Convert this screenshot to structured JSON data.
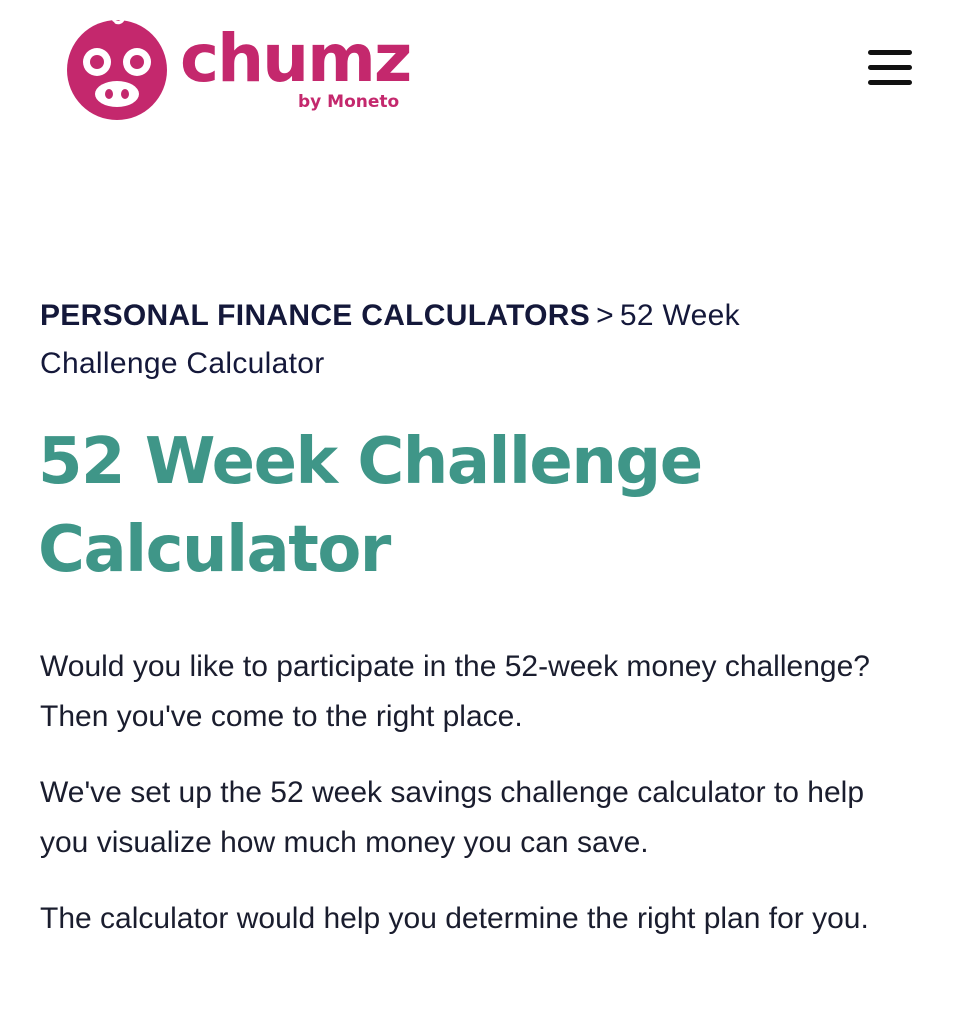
{
  "brand": {
    "name": "chumz",
    "byline": "by Moneto",
    "color": "#c4286d"
  },
  "header": {
    "menu_icon": "hamburger-menu-icon"
  },
  "breadcrumb": {
    "parent": "PERSONAL FINANCE CALCULATORS",
    "separator": ">",
    "current": "52 Week Challenge Calculator"
  },
  "page": {
    "title": "52 Week Challenge Calculator",
    "title_color": "#3f9688",
    "paragraphs": [
      "Would you like to participate in the 52-week money challenge? Then you've come to the right place.",
      "We've set up the 52 week savings challenge calculator to help you visualize how much money you can save.",
      "The calculator would help you determine the right plan for you."
    ]
  }
}
